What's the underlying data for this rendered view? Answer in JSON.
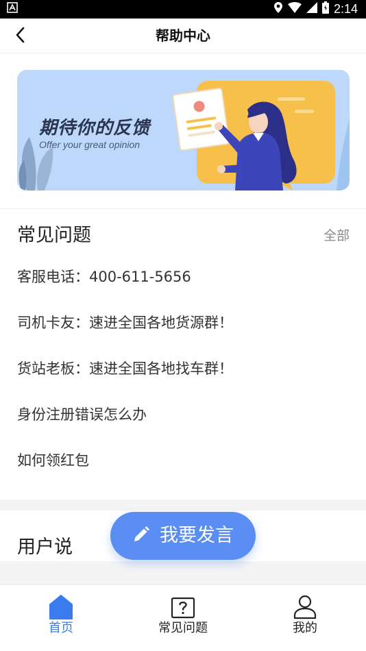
{
  "status_bar": {
    "time": "2:14",
    "left_icon": "app-notification-icon",
    "icons": [
      "location-icon",
      "wifi-icon",
      "signal-icon",
      "battery-icon"
    ]
  },
  "header": {
    "title": "帮助中心",
    "back_icon": "chevron-left-icon"
  },
  "banner": {
    "title": "期待你的反馈",
    "subtitle": "Offer your great opinion"
  },
  "faq": {
    "title": "常见问题",
    "all_link": "全部",
    "items": [
      "客服电话：400-611-5656",
      "司机卡友：速进全国各地货源群！",
      "货站老板：速进全国各地找车群！",
      "身份注册错误怎么办",
      "如何领红包"
    ]
  },
  "user_says": {
    "title": "用户说"
  },
  "post_button": {
    "label": "我要发言",
    "icon": "pencil-icon"
  },
  "tabbar": {
    "tabs": [
      {
        "label": "首页",
        "icon": "home-icon",
        "active": true
      },
      {
        "label": "常见问题",
        "icon": "question-icon",
        "active": false
      },
      {
        "label": "我的",
        "icon": "user-icon",
        "active": false
      }
    ]
  },
  "colors": {
    "accent": "#3a7cf0",
    "button": "#5b8ef2",
    "banner_bg": "#bdd8fa",
    "text_primary": "#222222",
    "text_secondary": "#888888"
  }
}
